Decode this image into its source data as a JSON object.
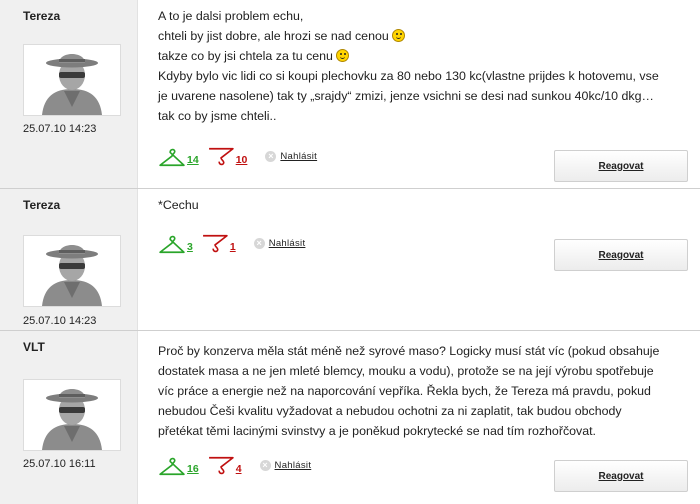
{
  "posts": [
    {
      "author": "Tereza",
      "date": "25.07.10 14:23",
      "lines": [
        "A to je dalsi problem echu,",
        "chteli by jist dobre, ale hrozi se nad cenou",
        "takze co by jsi chtela za tu cenu",
        "Kdyby bylo vic lidi co si koupi plechovku za 80 nebo 130 kc(vlastne prijdes k hotovemu, vse",
        "je uvarene nasolene) tak ty „srajdy“ zmizi, jenze vsichni se desi nad sunkou 40kc/10 dkg…",
        "tak co by jsme chteli.."
      ],
      "up": "14",
      "down": "10",
      "report": "Nahlásit",
      "reply": "Reagovat"
    },
    {
      "author": "Tereza",
      "date": "25.07.10 14:23",
      "lines": [
        "*Cechu"
      ],
      "up": "3",
      "down": "1",
      "report": "Nahlásit",
      "reply": "Reagovat"
    },
    {
      "author": "VLT",
      "date": "25.07.10 16:11",
      "lines": [
        "Proč by konzerva měla stát méně než syrové maso? Logicky musí stát víc (pokud obsahuje",
        "dostatek masa a ne jen mleté blemcy, mouku a vodu), protože se na její výrobu spotřebuje",
        "víc práce a energie než na naporcování vepříka. Řekla bych, že Tereza má pravdu, pokud",
        "nebudou Češi kvalitu vyžadovat a nebudou ochotni za ni zaplatit, tak budou obchody",
        "přetékat těmi lacinými svinstvy a je poněkud pokrytecké se nad tím rozhořčovat."
      ],
      "up": "16",
      "down": "4",
      "report": "Nahlásit",
      "reply": "Reagovat"
    }
  ],
  "colors": {
    "like": "#2aa52a",
    "dislike": "#c01010",
    "sidebar": "#f0f0f0"
  },
  "icons": {
    "like": "hanger-up-icon",
    "dislike": "hanger-down-icon",
    "report": "close-circle-icon",
    "avatar": "spy-avatar-icon"
  }
}
